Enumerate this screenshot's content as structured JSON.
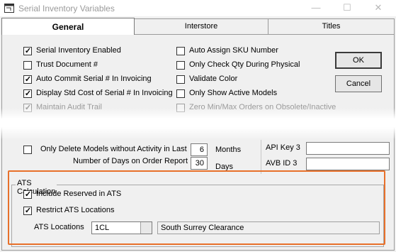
{
  "window": {
    "title": "Serial Inventory Variables"
  },
  "tabs": [
    "General",
    "Interstore",
    "Titles"
  ],
  "left_options": [
    {
      "label": "Serial Inventory Enabled",
      "checked": true,
      "disabled": false
    },
    {
      "label": "Trust Document #",
      "checked": false,
      "disabled": false
    },
    {
      "label": "Auto Commit Serial # In Invoicing",
      "checked": true,
      "disabled": false
    },
    {
      "label": "Display Std Cost of Serial # In Invoicing",
      "checked": true,
      "disabled": false
    },
    {
      "label": "Maintain Audit Trail",
      "checked": true,
      "disabled": true
    }
  ],
  "right_options": [
    {
      "label": "Auto Assign SKU Number",
      "checked": false,
      "disabled": false
    },
    {
      "label": "Only Check Qty During Physical",
      "checked": false,
      "disabled": false
    },
    {
      "label": "Validate Color",
      "checked": false,
      "disabled": false
    },
    {
      "label": "Only Show Active Models",
      "checked": false,
      "disabled": false
    },
    {
      "label": "Zero Min/Max Orders on Obsolete/Inactive",
      "checked": false,
      "disabled": true
    }
  ],
  "buttons": {
    "ok": "OK",
    "cancel": "Cancel"
  },
  "delete_models": {
    "label": "Only Delete Models without Activity in Last",
    "value": "6",
    "unit": "Months"
  },
  "order_report": {
    "label": "Number of Days on Order Report",
    "value": "30",
    "unit": "Days"
  },
  "api": {
    "key_label": "API Key 3",
    "key_value": "",
    "id_label": "AVB ID 3",
    "id_value": ""
  },
  "ats": {
    "group_title": "ATS Calculation",
    "include_reserved": {
      "label": "Include Reserved in ATS",
      "checked": true
    },
    "restrict_locations": {
      "label": "Restrict ATS Locations",
      "checked": true
    },
    "locations_label": "ATS Locations",
    "location_code": "1CL",
    "location_name": "South Surrey Clearance"
  },
  "colors": {
    "highlight": "#e8702a"
  },
  "icons": {
    "app": "app-window-icon",
    "minimize": "minimize-icon",
    "maximize": "maximize-icon",
    "close": "close-icon",
    "checkmark": "checkmark-icon"
  }
}
